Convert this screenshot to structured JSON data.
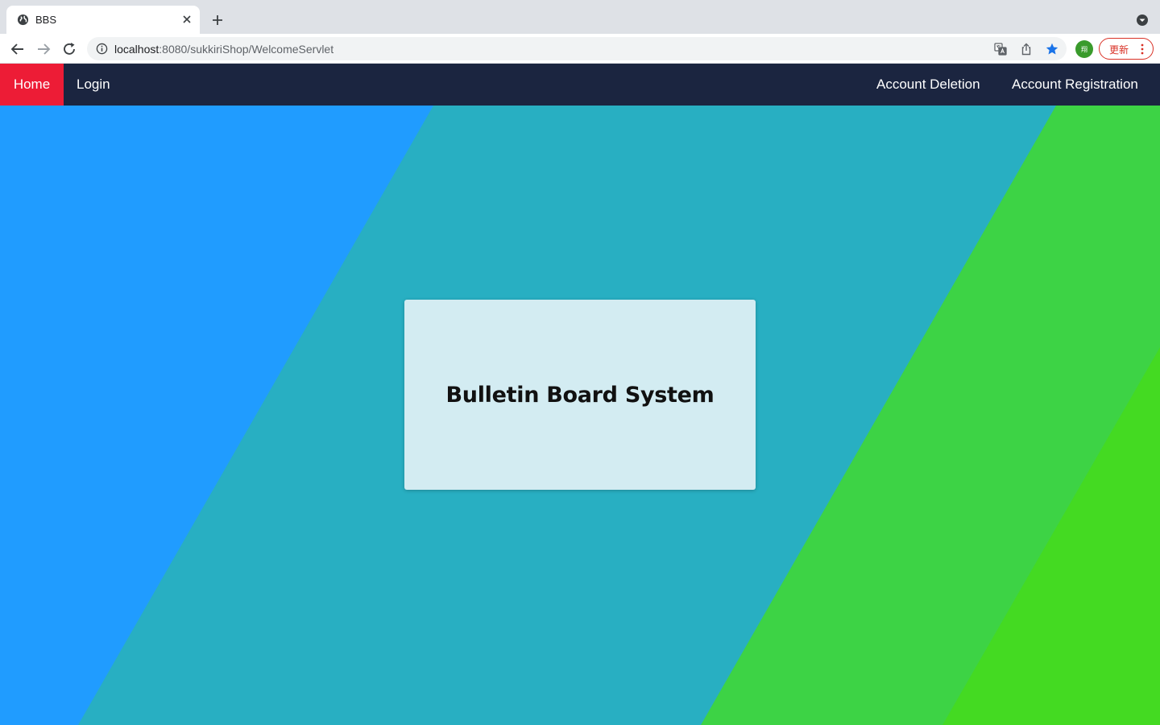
{
  "browser": {
    "tab": {
      "title": "BBS",
      "favicon": "globe-icon"
    },
    "address_bar": {
      "host": "localhost",
      "path": ":8080/sukkiriShop/WelcomeServlet"
    },
    "update_button": {
      "label": "更新"
    },
    "profile_avatar": {
      "initial": "翔",
      "color": "#3a9b2c"
    },
    "icons": [
      "back-arrow-icon",
      "forward-arrow-icon",
      "reload-icon",
      "info-icon",
      "translate-icon",
      "share-icon",
      "bookmark-star-icon",
      "kebab-menu-icon"
    ]
  },
  "site": {
    "nav": {
      "home": "Home",
      "login": "Login",
      "account_deletion": "Account Deletion",
      "account_registration": "Account Registration"
    },
    "card": {
      "title": "Bulletin Board System"
    },
    "colors": {
      "nav_bg": "#1b2540",
      "home_active": "#ed1c36",
      "bg_blue": "#209cff",
      "bg_teal": "#28afc2",
      "bg_green": "#3dd345",
      "bg_lime": "#44da22",
      "card_bg": "#d3ecf2"
    }
  }
}
